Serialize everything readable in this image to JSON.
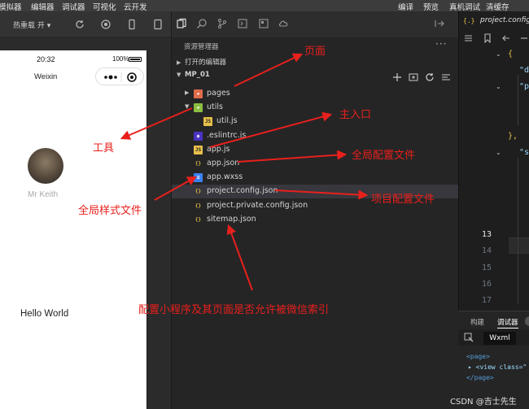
{
  "menubar": {
    "left": [
      "模拟器",
      "编辑器",
      "调试器",
      "可视化",
      "云开发"
    ],
    "right": [
      "编译",
      "预览",
      "真机调试",
      "清缓存"
    ]
  },
  "simulator_toolbar": {
    "hot_reload": "热重载 开 ▾"
  },
  "phone": {
    "time": "20:32",
    "battery": "100%",
    "title": "Weixin",
    "username": "Mr Keith",
    "hello": "Hello World"
  },
  "explorer": {
    "header": "资源管理器",
    "more": "···",
    "open_editors": "打开的编辑器",
    "project": "MP_01",
    "files": [
      {
        "name": "pages",
        "icon": "folder-pages-icon",
        "type": "folder",
        "depth": 1,
        "open": false
      },
      {
        "name": "utils",
        "icon": "folder-utils-icon",
        "type": "folder",
        "depth": 1,
        "open": true
      },
      {
        "name": "util.js",
        "icon": "js-file-icon",
        "type": "file",
        "depth": 2
      },
      {
        "name": ".eslintrc.js",
        "icon": "eslint-file-icon",
        "type": "file",
        "depth": 1
      },
      {
        "name": "app.js",
        "icon": "js-file-icon",
        "type": "file",
        "depth": 1
      },
      {
        "name": "app.json",
        "icon": "json-file-icon",
        "type": "file",
        "depth": 1
      },
      {
        "name": "app.wxss",
        "icon": "wxss-file-icon",
        "type": "file",
        "depth": 1
      },
      {
        "name": "project.config.json",
        "icon": "json-file-icon",
        "type": "file",
        "depth": 1,
        "selected": true
      },
      {
        "name": "project.private.config.json",
        "icon": "json-file-icon",
        "type": "file",
        "depth": 1
      },
      {
        "name": "sitemap.json",
        "icon": "json-file-icon",
        "type": "file",
        "depth": 1
      }
    ]
  },
  "editor": {
    "tab": "project.config.json",
    "tab_icon": "{.}",
    "lines": [
      {
        "n": "",
        "code": "{",
        "fold": true
      },
      {
        "n": "",
        "code": "\"d",
        "fold": false
      },
      {
        "n": "",
        "code": "\"p",
        "fold": true
      },
      {
        "n": "",
        "code": "",
        "fold": false
      },
      {
        "n": "",
        "code": "",
        "fold": false
      },
      {
        "n": "",
        "code": "},",
        "fold": false
      },
      {
        "n": "",
        "code": "\"s",
        "fold": true
      },
      {
        "n": "",
        "code": "",
        "fold": false
      },
      {
        "n": "",
        "code": "",
        "fold": false
      },
      {
        "n": "",
        "code": "",
        "fold": false
      },
      {
        "n": "",
        "code": "",
        "fold": false
      },
      {
        "n": "13",
        "code": "",
        "fold": false,
        "current": true
      },
      {
        "n": "14",
        "code": "",
        "fold": false
      },
      {
        "n": "15",
        "code": "",
        "fold": false
      },
      {
        "n": "16",
        "code": "",
        "fold": false
      },
      {
        "n": "17",
        "code": "",
        "fold": false
      }
    ]
  },
  "debug": {
    "tabs": [
      "构建",
      "调试器"
    ],
    "active_tab": "调试器",
    "wxml_tab": "Wxml",
    "xml_lines": [
      "<page>",
      "▸ <view class=\"",
      "</page>"
    ]
  },
  "annotations": {
    "page": "页面",
    "tools": "工具",
    "main_entry": "主入口",
    "global_config": "全局配置文件",
    "global_style": "全局样式文件",
    "project_config": "项目配置文件",
    "sitemap": "配置小程序及其页面是否允许被微信索引"
  },
  "watermark": "CSDN @吉士先生",
  "colors": {
    "annotation_red": "#e8201c",
    "json_icon": "#e8c04a",
    "selection": "#37373d"
  }
}
